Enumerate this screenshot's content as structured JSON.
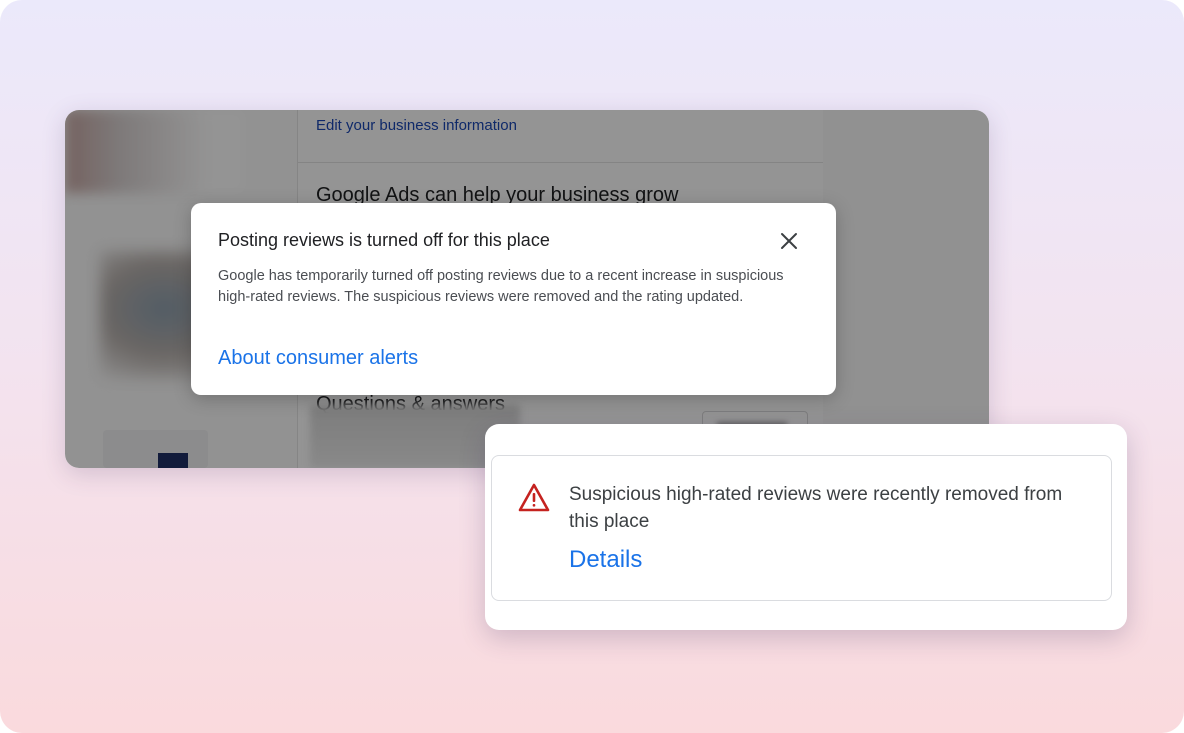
{
  "background_screen": {
    "edit_link": "Edit your business information",
    "ads_heading": "Google Ads can help your business grow",
    "qa_heading": "Questions & answers"
  },
  "dialog": {
    "title": "Posting reviews is turned off for this place",
    "body": "Google has temporarily turned off posting reviews due to a recent increase in suspicious high-rated reviews. The suspicious reviews were removed and the rating updated.",
    "link": "About consumer alerts",
    "close_icon": "close-icon"
  },
  "alert": {
    "icon": "warning-triangle-icon",
    "message": "Suspicious high-rated reviews were recently removed from this place",
    "link": "Details"
  },
  "colors": {
    "link": "#1a73e8",
    "warning": "#c5221f",
    "gradient_top": "#ebe9fb",
    "gradient_bottom": "#fadadd"
  }
}
